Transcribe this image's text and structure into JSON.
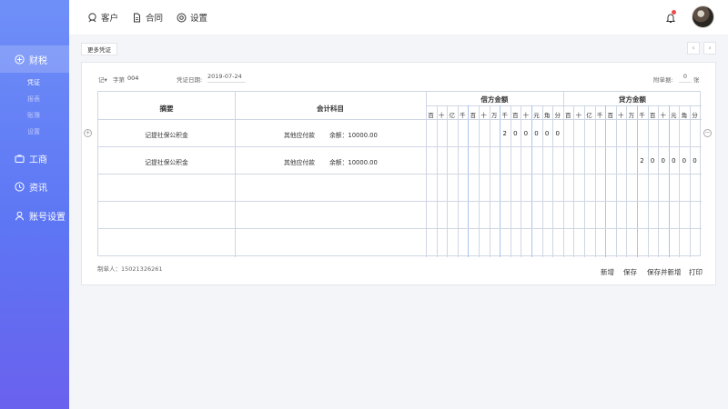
{
  "sidebar": {
    "items": [
      {
        "label": "财税",
        "icon": "circle-plus-icon"
      },
      {
        "label": "工商",
        "icon": "briefcase-icon"
      },
      {
        "label": "资讯",
        "icon": "clock-icon"
      },
      {
        "label": "账号设置",
        "icon": "user-icon"
      }
    ],
    "sub_items": [
      "凭证",
      "报表",
      "账簿",
      "设置"
    ]
  },
  "topnav": {
    "items": [
      {
        "label": "客户",
        "icon": "customer-icon"
      },
      {
        "label": "合同",
        "icon": "document-icon"
      },
      {
        "label": "设置",
        "icon": "settings-icon"
      }
    ]
  },
  "toolbar": {
    "more_label": "更多凭证",
    "prev": "‹",
    "next": "›"
  },
  "voucher": {
    "type": "记",
    "number_label": "字第",
    "number": "004",
    "date_label": "凭证日期:",
    "date": "2019-07-24",
    "attach_label": "附单据:",
    "attach_count": "0",
    "attach_unit": "张"
  },
  "ledger": {
    "col_summary": "摘要",
    "col_account": "会计科目",
    "col_debit": "借方金额",
    "col_credit": "贷方金额",
    "digit_headers": [
      "百",
      "十",
      "亿",
      "千",
      "百",
      "十",
      "万",
      "千",
      "百",
      "十",
      "元",
      "角",
      "分"
    ],
    "rows": [
      {
        "summary": "记提社保公积金",
        "account": "其他应付款",
        "balance": "余额：10000.00",
        "debit_digits": [
          "",
          "",
          "",
          "",
          "",
          "",
          "",
          "2",
          "0",
          "0",
          "0",
          "0",
          "0"
        ],
        "credit_digits": [
          "",
          "",
          "",
          "",
          "",
          "",
          "",
          "",
          "",
          "",
          "",
          "",
          ""
        ]
      },
      {
        "summary": "记提社保公积金",
        "account": "其他应付款",
        "balance": "余额：10000.00",
        "debit_digits": [
          "",
          "",
          "",
          "",
          "",
          "",
          "",
          "",
          "",
          "",
          "",
          "",
          ""
        ],
        "credit_digits": [
          "",
          "",
          "",
          "",
          "",
          "",
          "",
          "2",
          "0",
          "0",
          "0",
          "0",
          "0"
        ]
      },
      {
        "summary": "",
        "account": "",
        "balance": "",
        "debit_digits": [],
        "credit_digits": []
      },
      {
        "summary": "",
        "account": "",
        "balance": "",
        "debit_digits": [],
        "credit_digits": []
      },
      {
        "summary": "",
        "account": "",
        "balance": "",
        "debit_digits": [],
        "credit_digits": []
      }
    ]
  },
  "footer": {
    "maker": "制单人：15021326261",
    "actions": [
      "新增",
      "保存",
      "保存并新增",
      "打印"
    ]
  },
  "colors": {
    "sidebar_top": "#6f8ff8",
    "sidebar_bottom": "#6a61ee",
    "alert": "#f04b4b",
    "grid_blue": "#a9c4ee"
  }
}
